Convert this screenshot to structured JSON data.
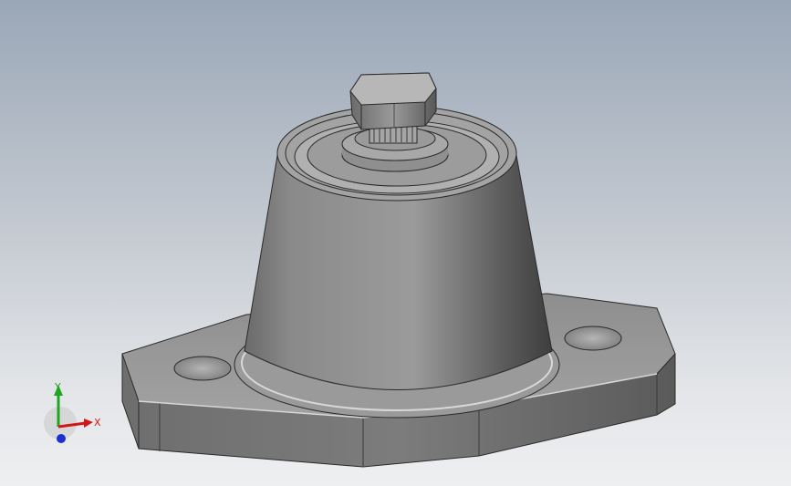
{
  "viewport": {
    "background_top": "#9aa7b7",
    "background_bottom": "#eeeff1"
  },
  "model": {
    "body_color": "#8c8c8c",
    "edge_color": "#2a2a2a"
  },
  "triad": {
    "x_label": "X",
    "y_label": "Y",
    "x_color": "#d01818",
    "y_color": "#1fa51f",
    "z_color": "#1c2fd0"
  }
}
